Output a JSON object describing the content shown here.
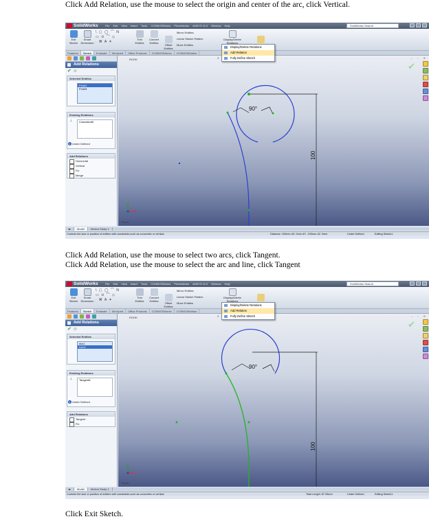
{
  "captions": {
    "step1": "Click Add Relation, use the mouse to select the origin and center of the arc, click Vertical.",
    "step2a": "Click Add Relation, use the mouse to select two arcs, click Tangent.",
    "step2b": "Click Add Relation, use the mouse to select the arc and line, click Tangent",
    "step3": "Click Exit Sketch."
  },
  "app": {
    "logo": "SolidWorks",
    "menus": [
      "File",
      "Edit",
      "View",
      "Insert",
      "Tools",
      "COSMOSWorks",
      "PhotoWorks",
      "ANSYS 11.0",
      "Window",
      "Help"
    ],
    "search_placeholder": "SolidWorks Search",
    "ribbon": {
      "exit_sketch": "Exit Sketch",
      "smart_dimension": "Smart Dimension",
      "trim_entities": "Trim Entities",
      "convert_entities": "Convert Entities",
      "offset_entities": "Offset Entities",
      "mirror_entities": "Mirror Entities",
      "linear_pattern": "Linear Sketch Pattern",
      "move_entities": "Move Entities",
      "display_delete": "Display/Delete Relations",
      "rapid_sketch": "Rapid Sketch"
    },
    "tabs": [
      "Features",
      "Sketch",
      "Evaluate",
      "DimXpert",
      "Office Products",
      "COSMOSWorks",
      "COSMOSMotion"
    ],
    "active_tab": "Sketch",
    "relations_menu": [
      "Display/Delete Relations",
      "Add Relation",
      "Fully Define Sketch"
    ],
    "panel_title": "Add Relations",
    "selected_entities_header": "Selected Entities",
    "existing_relations_header": "Existing Relations",
    "add_relations_header": "Add Relations",
    "bottom_tabs": [
      "Model",
      "Motion Study 1"
    ],
    "vp_origin": "*Front"
  },
  "screens": [
    {
      "feature_label": "ROOK",
      "selected": [
        "Point1",
        "Point3"
      ],
      "existing": [
        "Coincident0"
      ],
      "status_state": "Under Defined",
      "relations": [
        "Horizontal",
        "Vertical",
        "Fix",
        "Merge"
      ],
      "dimension": "90°",
      "length": "100",
      "status_hint": "Controls the size or position of entities with constraints such as concentric or vertical.",
      "status_measure": "Distance: 100mm   dX: 0mm   dY: -100mm   dZ: 0mm",
      "status_define": "Under Defined",
      "status_mode": "Editing Sketch1"
    },
    {
      "feature_label": "ROOK",
      "selected": [
        "Arc1",
        "Line1"
      ],
      "existing": [
        "Tangent6"
      ],
      "status_state": "Under Defined",
      "relations": [
        "Tangent",
        "Fix"
      ],
      "dimension": "90°",
      "length": "100",
      "status_hint": "Controls the size or position of entities with constraints such as concentric or vertical.",
      "status_measure": "Total Length: 87.95mm",
      "status_define": "Under Defined",
      "status_mode": "Editing Sketch1"
    }
  ],
  "colors": {
    "sketch_blue": "#2a3fd0",
    "selected_green": "#22b422",
    "dimension_line": "#1a1a1a"
  }
}
